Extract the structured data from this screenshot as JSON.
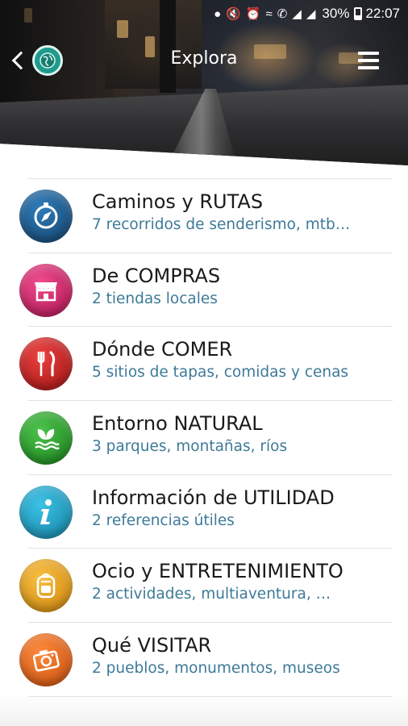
{
  "status_bar": {
    "battery_percent": "30%",
    "time": "22:07",
    "icons": [
      "location-icon",
      "mute-icon",
      "alarm-icon",
      "wifi-icon",
      "call-icon",
      "signal-icon",
      "signal-icon",
      "battery-icon"
    ]
  },
  "header": {
    "title": "Explora",
    "back_icon": "chevron-left-icon",
    "logo_icon": "globe-icon",
    "menu_icon": "hamburger-menu-icon"
  },
  "items": [
    {
      "title": "Caminos y RUTAS",
      "subtitle": "7 recorridos de senderismo, mtb…",
      "icon": "compass-icon",
      "color": "#1e5a8c"
    },
    {
      "title": "De COMPRAS",
      "subtitle": "2 tiendas locales",
      "icon": "shop-icon",
      "color": "#d81e6a"
    },
    {
      "title": "Dónde COMER",
      "subtitle": "5 sitios de tapas, comidas y cenas",
      "icon": "fork-knife-icon",
      "color": "#d21f1f"
    },
    {
      "title": "Entorno NATURAL",
      "subtitle": "3 parques, montañas, ríos",
      "icon": "leaf-icon",
      "color": "#2ba32b"
    },
    {
      "title": "Información de UTILIDAD",
      "subtitle": "2 referencias útiles",
      "icon": "info-icon",
      "color": "#1aa3c9"
    },
    {
      "title": "Ocio y ENTRETENIMIENTO",
      "subtitle": "2 actividades, multiaventura, …",
      "icon": "backpack-icon",
      "color": "#eda41a"
    },
    {
      "title": "Qué VISITAR",
      "subtitle": "2 pueblos, monumentos, museos",
      "icon": "camera-icon",
      "color": "#ef6a1e"
    }
  ]
}
